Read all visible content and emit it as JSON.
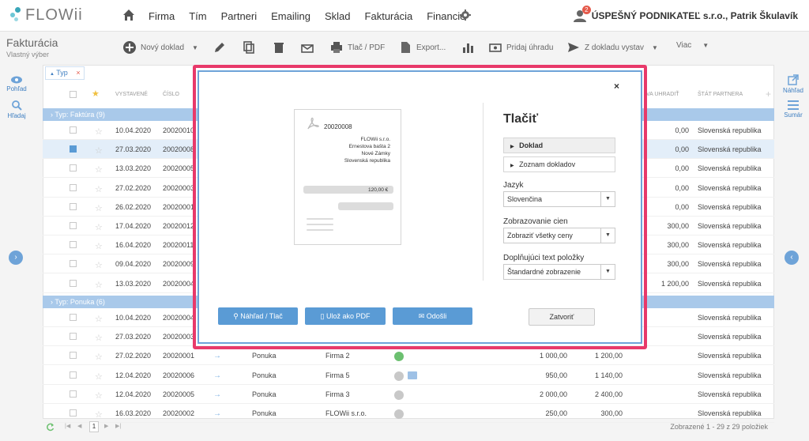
{
  "app": {
    "logo_text": "FLOWii"
  },
  "nav": {
    "items": [
      "Firma",
      "Tím",
      "Partneri",
      "Emailing",
      "Sklad",
      "Fakturácia",
      "Financie"
    ],
    "notification_count": "2",
    "user": "ÚSPEŠNÝ PODNIKATEĽ s.r.o., Patrik Škulavík"
  },
  "toolbar": {
    "title": "Fakturácia",
    "subtitle": "Vlastný výber",
    "new_doc": "Nový doklad",
    "print": "Tlač / PDF",
    "export": "Export...",
    "add_payment": "Pridaj úhradu",
    "from_doc": "Z dokladu vystav",
    "more": "Viac"
  },
  "left_panel": {
    "view": "Pohľad",
    "search": "Hľadaj"
  },
  "right_panel": {
    "preview": "Náhľad",
    "summary": "Sumár"
  },
  "filter": {
    "label": "Typ"
  },
  "columns": {
    "issued": "VYSTAVENÉ",
    "number": "ČÍSLO",
    "to_pay": "VA UHRADIŤ",
    "country": "ŠTÁT PARTNERA"
  },
  "groups": {
    "invoice": "Typ: Faktúra (9)",
    "offer": "Typ: Ponuka (6)"
  },
  "rows_invoice": [
    {
      "date": "10.04.2020",
      "num": "20020010",
      "amount": "0,00",
      "country": "Slovenská republika",
      "selected": false
    },
    {
      "date": "27.03.2020",
      "num": "20020008",
      "amount": "0,00",
      "country": "Slovenská republika",
      "selected": true
    },
    {
      "date": "13.03.2020",
      "num": "20020005",
      "amount": "0,00",
      "country": "Slovenská republika",
      "selected": false
    },
    {
      "date": "27.02.2020",
      "num": "20020003",
      "amount": "0,00",
      "country": "Slovenská republika",
      "selected": false
    },
    {
      "date": "26.02.2020",
      "num": "20020001",
      "amount": "0,00",
      "country": "Slovenská republika",
      "selected": false
    },
    {
      "date": "17.04.2020",
      "num": "20020012",
      "amount": "300,00",
      "country": "Slovenská republika",
      "selected": false
    },
    {
      "date": "16.04.2020",
      "num": "20020011",
      "amount": "300,00",
      "country": "Slovenská republika",
      "selected": false
    },
    {
      "date": "09.04.2020",
      "num": "20020009",
      "amount": "300,00",
      "country": "Slovenská republika",
      "selected": false
    },
    {
      "date": "13.03.2020",
      "num": "20020004",
      "amount": "1 200,00",
      "country": "Slovenská republika",
      "selected": false
    }
  ],
  "rows_offer": [
    {
      "date": "10.04.2020",
      "num": "20020004",
      "type": "",
      "partner": "",
      "net": "",
      "amount": "",
      "country": "Slovenská republika",
      "status": ""
    },
    {
      "date": "27.03.2020",
      "num": "20020003",
      "type": "",
      "partner": "",
      "net": "",
      "amount": "",
      "country": "Slovenská republika",
      "status": ""
    },
    {
      "date": "27.02.2020",
      "num": "20020001",
      "type": "Ponuka",
      "partner": "Firma 2",
      "net": "1 000,00",
      "amount": "1 200,00",
      "country": "Slovenská republika",
      "status": "ok"
    },
    {
      "date": "12.04.2020",
      "num": "20020006",
      "type": "Ponuka",
      "partner": "Firma 5",
      "net": "950,00",
      "amount": "1 140,00",
      "country": "Slovenská republika",
      "status": "h-mail"
    },
    {
      "date": "12.04.2020",
      "num": "20020005",
      "type": "Ponuka",
      "partner": "Firma 3",
      "net": "2 000,00",
      "amount": "2 400,00",
      "country": "Slovenská republika",
      "status": "h"
    },
    {
      "date": "16.03.2020",
      "num": "20020002",
      "type": "Ponuka",
      "partner": "FLOWii s.r.o.",
      "net": "250,00",
      "amount": "300,00",
      "country": "Slovenská republika",
      "status": "h"
    }
  ],
  "footer": {
    "page": "1",
    "summary": "Zobrazené 1 - 29 z 29 položiek"
  },
  "modal": {
    "title": "Tlačiť",
    "tab_doc": "Doklad",
    "tab_list": "Zoznam dokladov",
    "lang_label": "Jazyk",
    "lang_value": "Slovenčina",
    "price_label": "Zobrazovanie cien",
    "price_value": "Zobraziť všetky ceny",
    "extra_label": "Doplňujúci text položky",
    "extra_value": "Štandardné zobrazenie",
    "btn_preview": "Náhľad / Tlač",
    "btn_pdf": "Ulož ako PDF",
    "btn_send": "Odošli",
    "btn_close": "Zatvoriť",
    "doc": {
      "number": "20020008",
      "lines": [
        "FLOWii s.r.o.",
        "Ernestova bašta 2",
        "Nové Zámky",
        "Slovenská republika"
      ],
      "amount": "120,00 €"
    }
  },
  "colors": {
    "accent": "#5a9bd5",
    "highlight": "#e8396a",
    "group": "#a9c9ea"
  }
}
